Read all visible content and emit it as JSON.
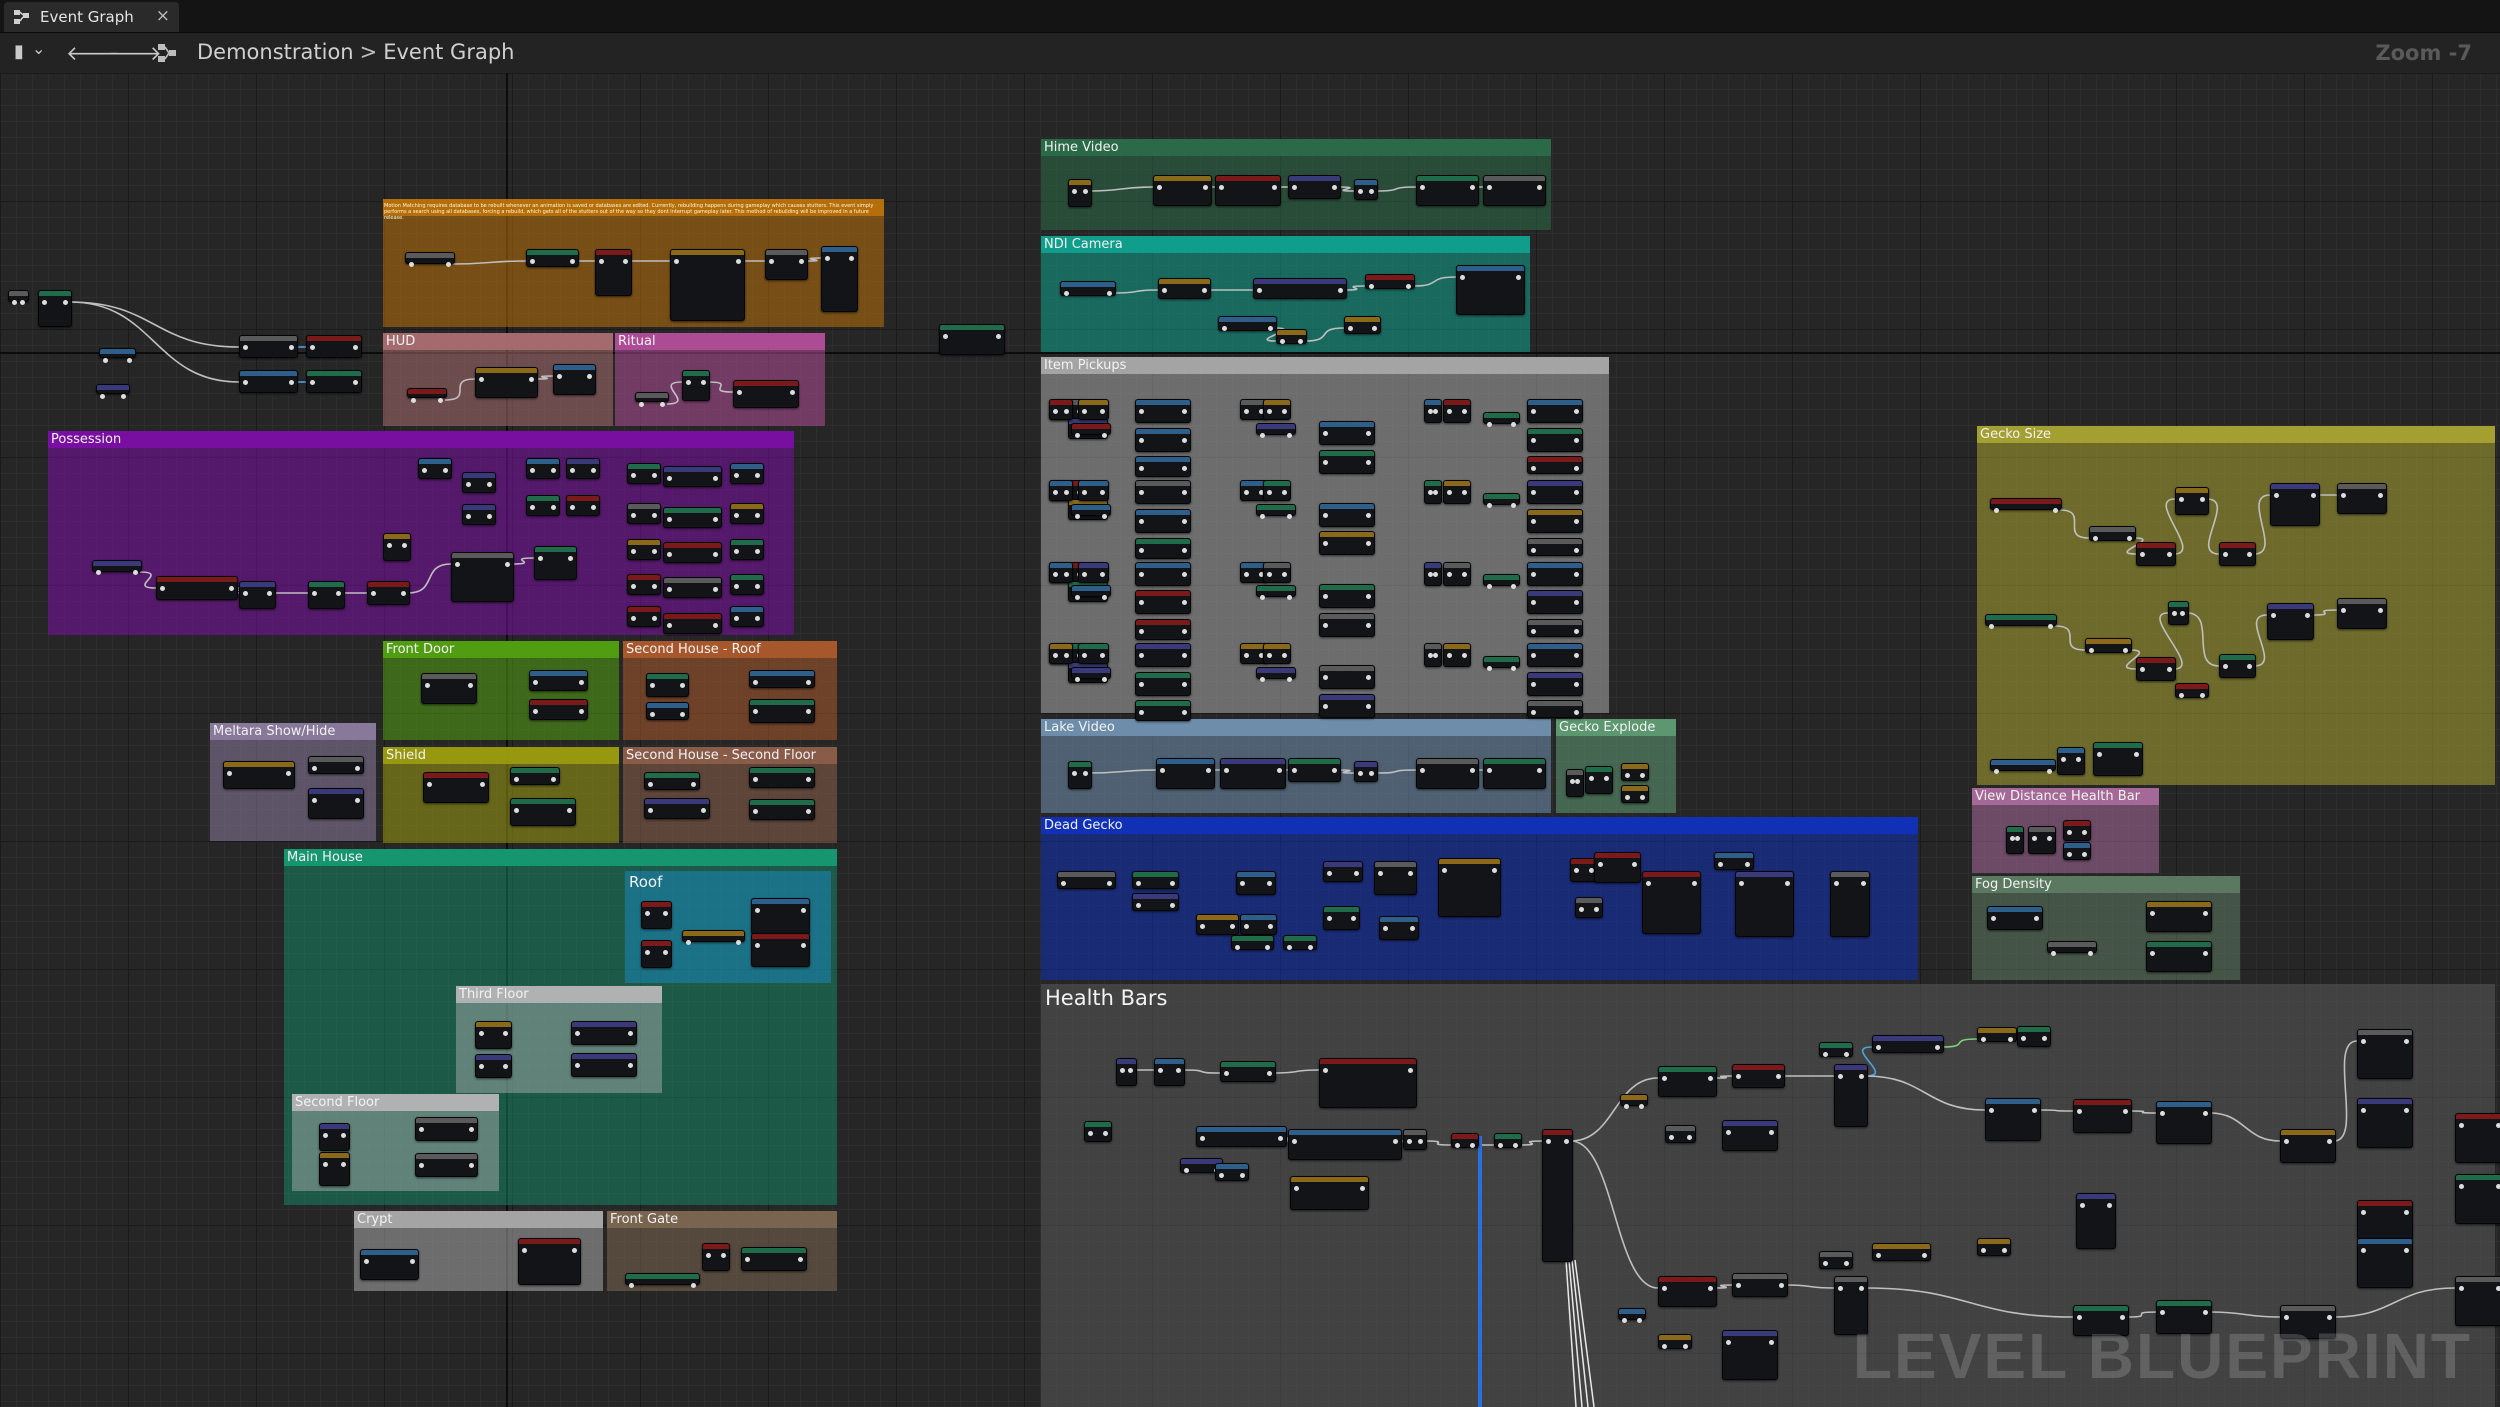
{
  "tab": {
    "title": "Event Graph",
    "close_glyph": "×"
  },
  "toolbar": {
    "bookmark_glyph": "▮",
    "dropdown_glyph": "⌄",
    "back_glyph": "🡐",
    "forward_glyph": "🡒"
  },
  "breadcrumb": {
    "root": "Demonstration",
    "separator": ">",
    "current": "Event Graph"
  },
  "zoom": "Zoom -7",
  "watermark": "LEVEL BLUEPRINT",
  "annotation": "Motion Matching requires database to be rebuilt whenever an animation is saved or databases are edited. Currently, rebuilding happens during gameplay which causes stutters. This event simply performs a search using all databases, forcing a rebuild, which gets all of the stutters out of the way so they dont interrupt gameplay later. This method of rebuilding will be improved in a future release.",
  "comments": [
    {
      "id": "motion-matching",
      "title": "",
      "color": "#b8700a"
    },
    {
      "id": "hud",
      "title": "HUD",
      "color": "#a86b6f"
    },
    {
      "id": "ritual",
      "title": "Ritual",
      "color": "#b04d98"
    },
    {
      "id": "possession",
      "title": "Possession",
      "color": "#7a0fa3"
    },
    {
      "id": "front-door",
      "title": "Front Door",
      "color": "#52a012"
    },
    {
      "id": "second-house-roof",
      "title": "Second House - Roof",
      "color": "#a95a2c"
    },
    {
      "id": "meltara-show-hide",
      "title": "Meltara Show/Hide",
      "color": "#8a7a9c"
    },
    {
      "id": "shield",
      "title": "Shield",
      "color": "#9b9a10"
    },
    {
      "id": "second-house-second-floor",
      "title": "Second House - Second Floor",
      "color": "#8a5e4a"
    },
    {
      "id": "main-house",
      "title": "Main House",
      "color": "#159a72"
    },
    {
      "id": "roof",
      "title": "Roof",
      "color": "#1a8fd1"
    },
    {
      "id": "third-floor",
      "title": "Third Floor",
      "color": "#b4b4b4"
    },
    {
      "id": "second-floor",
      "title": "Second Floor",
      "color": "#b4b4b4"
    },
    {
      "id": "crypt",
      "title": "Crypt",
      "color": "#a8a8a8"
    },
    {
      "id": "front-gate",
      "title": "Front Gate",
      "color": "#7b6650"
    },
    {
      "id": "hime-video",
      "title": "Hime Video",
      "color": "#2b6b49"
    },
    {
      "id": "ndi-camera",
      "title": "NDI Camera",
      "color": "#0fa08e"
    },
    {
      "id": "item-pickups",
      "title": "Item Pickups",
      "color": "#a8a8a8"
    },
    {
      "id": "lake-video",
      "title": "Lake Video",
      "color": "#6f8fae"
    },
    {
      "id": "gecko-explode",
      "title": "Gecko Explode",
      "color": "#5e9a72"
    },
    {
      "id": "dead-gecko",
      "title": "Dead Gecko",
      "color": "#1030b8"
    },
    {
      "id": "health-bars",
      "title": "Health Bars",
      "color": "#6a6a6a"
    },
    {
      "id": "gecko-size",
      "title": "Gecko Size",
      "color": "#a8a232"
    },
    {
      "id": "view-distance-health-bar",
      "title": "View Distance Health Bar",
      "color": "#a86a9a"
    },
    {
      "id": "fog-density",
      "title": "Fog Density",
      "color": "#5d7a62"
    }
  ]
}
